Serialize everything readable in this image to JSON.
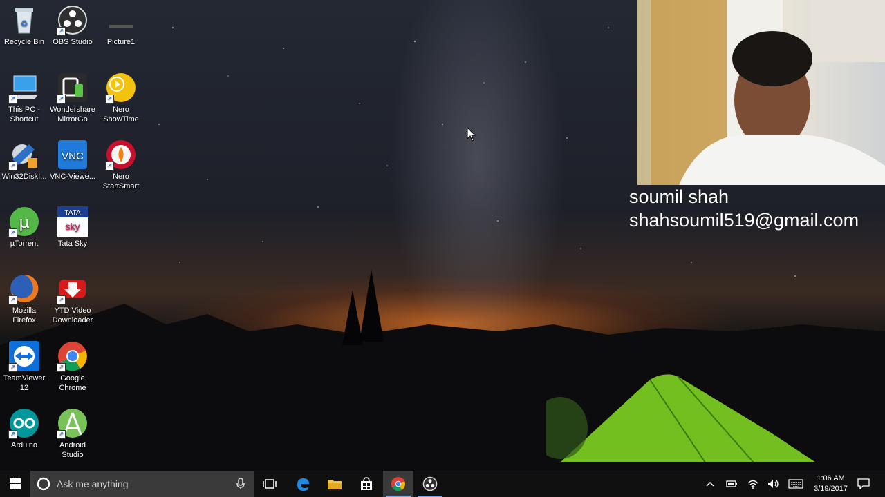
{
  "desktop": {
    "icons": [
      {
        "label": "Recycle Bin",
        "icon": "recycle-bin-icon"
      },
      {
        "label": "OBS Studio",
        "icon": "obs-icon"
      },
      {
        "label": "Picture1",
        "icon": "picture-icon"
      },
      {
        "label": "This PC - Shortcut",
        "icon": "computer-icon"
      },
      {
        "label": "Wondershare MirrorGo",
        "icon": "mirrorgo-icon"
      },
      {
        "label": "Nero ShowTime",
        "icon": "nero-showtime-icon"
      },
      {
        "label": "Win32DiskI...",
        "icon": "disk-imager-icon"
      },
      {
        "label": "VNC-Viewe...",
        "icon": "vnc-icon"
      },
      {
        "label": "Nero StartSmart",
        "icon": "nero-startsmart-icon"
      },
      {
        "label": "µTorrent",
        "icon": "utorrent-icon"
      },
      {
        "label": "Tata Sky",
        "icon": "tatasky-icon"
      },
      {
        "label": "Mozilla Firefox",
        "icon": "firefox-icon"
      },
      {
        "label": "YTD Video Downloader",
        "icon": "ytd-icon"
      },
      {
        "label": "TeamViewer 12",
        "icon": "teamviewer-icon"
      },
      {
        "label": "Google Chrome",
        "icon": "chrome-icon"
      },
      {
        "label": "Arduino",
        "icon": "arduino-icon"
      },
      {
        "label": "Android Studio",
        "icon": "android-studio-icon"
      }
    ],
    "tatasky_logo_top": "TATA",
    "tatasky_logo_bottom": "sky",
    "vnc_logo": "VNC"
  },
  "overlay": {
    "name": "soumil shah",
    "email": "shahsoumil519@gmail.com"
  },
  "taskbar": {
    "search_placeholder": "Ask me anything",
    "time": "1:06 AM",
    "date": "3/19/2017",
    "apps": [
      "task-view",
      "edge",
      "file-explorer",
      "store",
      "chrome",
      "obs"
    ],
    "active_app": "chrome"
  },
  "colors": {
    "taskbar_bg": "#101010",
    "search_bg": "#3a3a3a",
    "tent_green": "#7ed321",
    "accent_blue": "#7aa7d9"
  }
}
